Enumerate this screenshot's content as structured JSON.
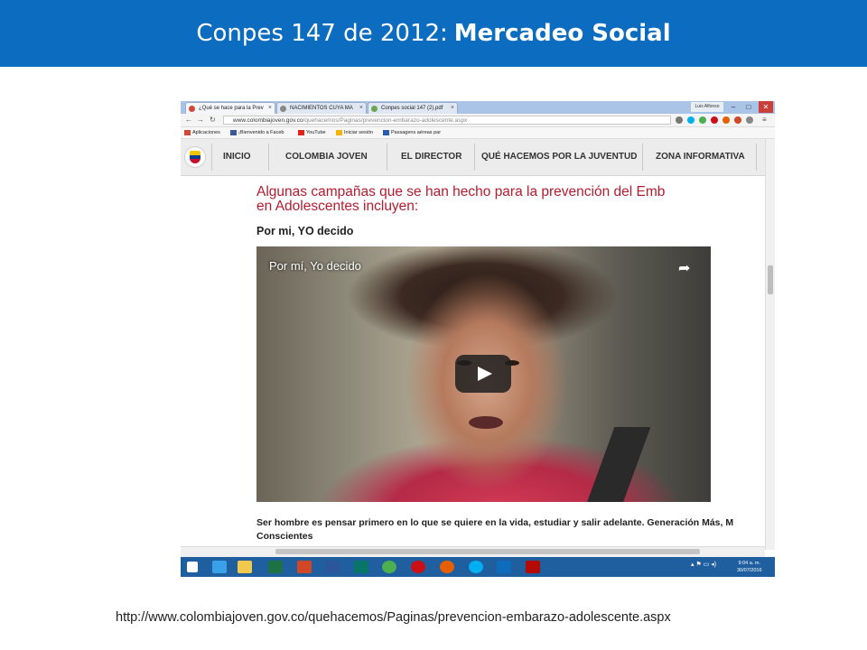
{
  "slide": {
    "title_plain": "Conpes 147 de 2012:",
    "title_bold": "Mercadeo Social",
    "footer_url": "http://www.colombiajoven.gov.co/quehacemos/Paginas/prevencion-embarazo-adolescente.aspx"
  },
  "browser": {
    "tabs": [
      {
        "label": "¿Qué se hace para la Prev",
        "favicon_color": "#d14836"
      },
      {
        "label": "NACIMIENTOS CUYA MA",
        "favicon_color": "#888888"
      },
      {
        "label": "Conpes social 147 (2).pdf",
        "favicon_color": "#6aa84f"
      }
    ],
    "user": "Luis Alfonso",
    "window_buttons": [
      "–",
      "□",
      "✕"
    ],
    "address": {
      "domain": "www.colombiajoven.gov.co",
      "path": "/quehacemos/Paginas/prevencion-embarazo-adolescente.aspx"
    },
    "bookmarks": [
      {
        "label": "Aplicaciones",
        "color": "#d14836"
      },
      {
        "label": "¡Bienvenido a Faceb",
        "color": "#3b5998"
      },
      {
        "label": "YouTube",
        "color": "#e62117"
      },
      {
        "label": "Iniciar sesión",
        "color": "#f4b400"
      },
      {
        "label": "Passagens aéreas par",
        "color": "#2a5db0"
      }
    ]
  },
  "site": {
    "nav": [
      "INICIO",
      "COLOMBIA JOVEN",
      "EL DIRECTOR",
      "QUÉ HACEMOS POR LA JUVENTUD",
      "ZONA INFORMATIVA"
    ],
    "heading_line1": "Algunas campañas que se han hecho para la prevención del Emb",
    "heading_line2": "en Adolescentes incluyen:",
    "subheading": "Por mi, YO decido",
    "video_title": "Por mí, Yo decido",
    "caption_line1": "Ser hombre es pensar primero en lo que se quiere en la vida, estudiar y salir adelante. Generación Más, M",
    "caption_line2": "Conscientes"
  },
  "taskbar": {
    "apps": [
      {
        "name": "windows-start",
        "color": "#ffffff"
      },
      {
        "name": "internet-explorer",
        "color": "#3aa0e8"
      },
      {
        "name": "file-explorer",
        "color": "#f2c94c"
      },
      {
        "name": "excel",
        "color": "#1d7245"
      },
      {
        "name": "powerpoint",
        "color": "#d24726"
      },
      {
        "name": "word",
        "color": "#2b579a"
      },
      {
        "name": "publisher",
        "color": "#077568"
      },
      {
        "name": "chrome",
        "color": "#4caf50"
      },
      {
        "name": "opera",
        "color": "#cc0f16"
      },
      {
        "name": "firefox",
        "color": "#e66000"
      },
      {
        "name": "skype",
        "color": "#00aff0"
      },
      {
        "name": "mail",
        "color": "#0f6cbd"
      },
      {
        "name": "acrobat",
        "color": "#b30b00"
      }
    ],
    "time": "9:04 a. m.",
    "date": "30/07/2016"
  }
}
